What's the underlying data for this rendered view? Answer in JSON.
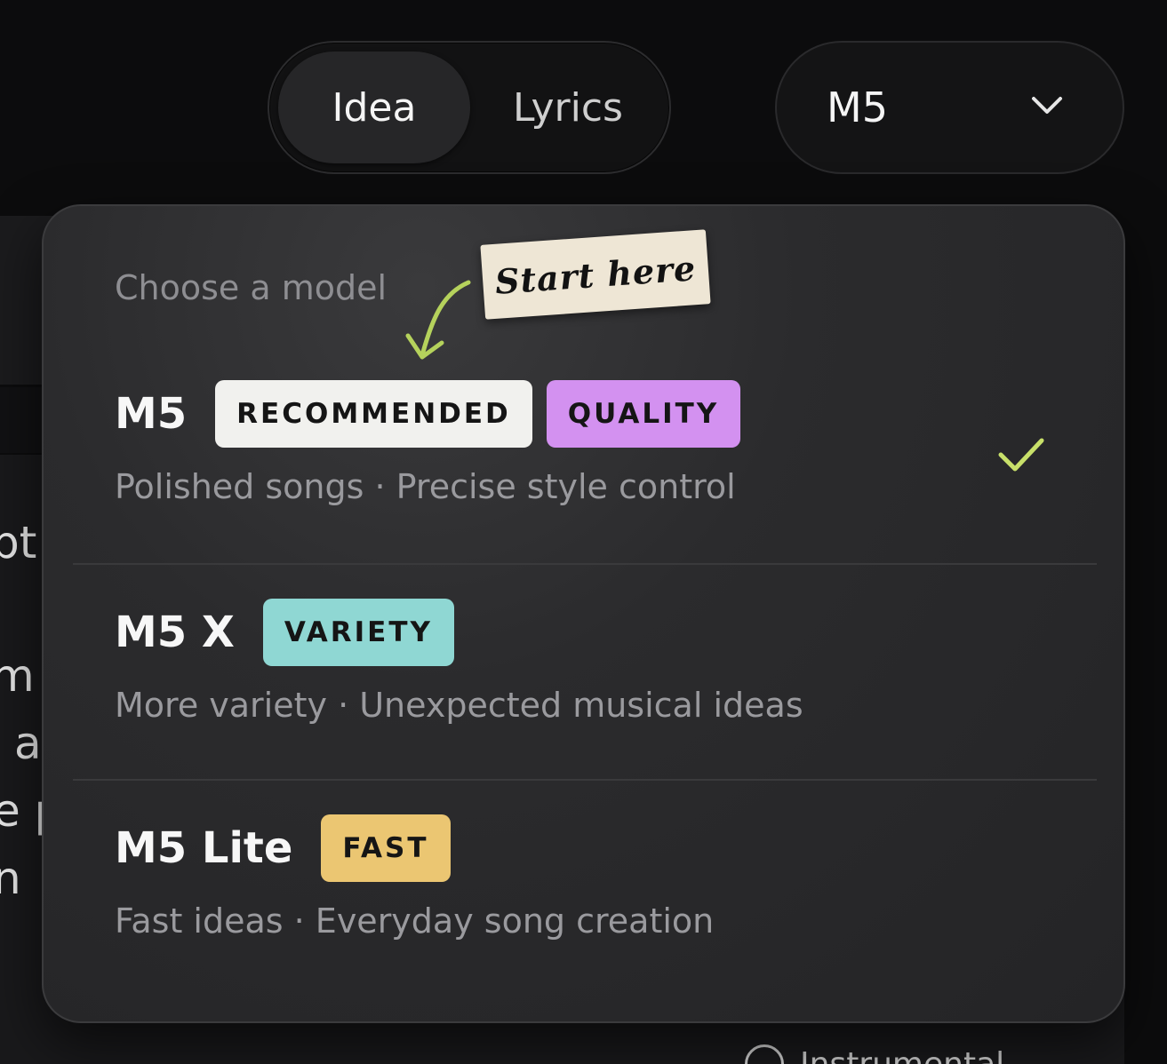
{
  "mode_toggle": {
    "options": [
      {
        "label": "Idea",
        "selected": true
      },
      {
        "label": "Lyrics",
        "selected": false
      }
    ]
  },
  "model_select": {
    "value": "M5",
    "icon": "chevron-down-icon"
  },
  "menu": {
    "heading": "Choose a model",
    "sticker": "Start here",
    "options": [
      {
        "name": "M5",
        "badges": [
          "RECOMMENDED",
          "QUALITY"
        ],
        "description": "Polished songs · Precise style control",
        "selected": true
      },
      {
        "name": "M5 X",
        "badges": [
          "VARIETY"
        ],
        "description": "More variety · Unexpected musical ideas",
        "selected": false
      },
      {
        "name": "M5 Lite",
        "badges": [
          "FAST"
        ],
        "description": "Fast ideas · Everyday song creation",
        "selected": false
      }
    ]
  },
  "colors": {
    "accent_check": "#c8e06a",
    "badge_recommended": "#f1f1ee",
    "badge_quality": "#d391f0",
    "badge_variety": "#8fd7d3",
    "badge_fast": "#ebc672",
    "arrow": "#b5d25c"
  },
  "background_fragments": {
    "lines": [
      "pt",
      "m",
      "a",
      "e p",
      "n"
    ],
    "footer": "Instrumental"
  }
}
